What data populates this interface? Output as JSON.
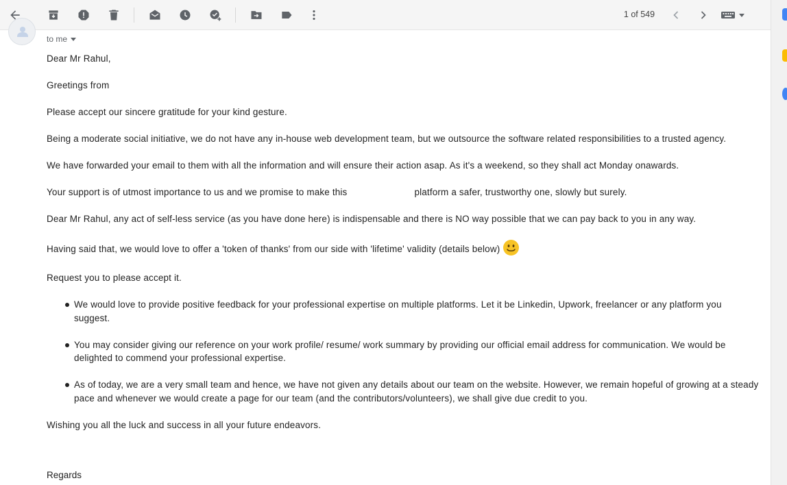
{
  "toolbar": {
    "pager_text": "1 of 549",
    "icons": [
      "back-arrow-icon",
      "archive-icon",
      "report-spam-icon",
      "delete-icon",
      "mark-unread-icon",
      "snooze-icon",
      "add-task-icon",
      "move-to-icon",
      "label-icon",
      "more-vert-icon",
      "chevron-left-icon",
      "chevron-right-icon",
      "keyboard-icon"
    ]
  },
  "header": {
    "recipient_label": "to me"
  },
  "email": {
    "salutation": "Dear Mr Rahul,",
    "greeting": "Greetings from",
    "p1": "Please accept our sincere gratitude for your kind gesture.",
    "p2": "Being a moderate social initiative, we do not have any in-house web development team, but we outsource the software related responsibilities to a trusted agency.",
    "p3": "We have forwarded your email to them with all the information and will ensure their action asap.  As it's a weekend, so they shall act Monday onawards.",
    "p4_before": "Your support is of utmost importance to us and we promise to make this",
    "p4_after": "platform a safer, trustworthy one, slowly but surely.",
    "p5": "Dear Mr Rahul, any act of self-less service (as you have done here) is indispensable and there is NO way possible that we can pay back to you in any way.",
    "p6": "Having said that, we would love to offer a 'token of thanks' from our side with 'lifetime' validity (details below)",
    "p7": "Request you to please accept it.",
    "bullets": [
      "We would love to provide positive feedback for your professional expertise on multiple platforms. Let it be Linkedin, Upwork, freelancer or any platform you suggest.",
      "You may consider giving our reference on your work profile/ resume/ work summary by providing our official email address for communication. We would be delighted to commend your professional expertise.",
      "As of today, we are a very small team and hence, we have not given any details about our team on the website. However, we remain hopeful of growing at a steady pace and whenever we would create a page for our team (and the contributors/volunteers), we shall give due credit to you."
    ],
    "closing": "Wishing you all the luck and success in all your future endeavors.",
    "regards": "Regards"
  },
  "colors": {
    "icon": "#5f6368",
    "text": "#222222",
    "toolbar_bg": "#f5f5f5",
    "emoji": "#f7c325"
  }
}
